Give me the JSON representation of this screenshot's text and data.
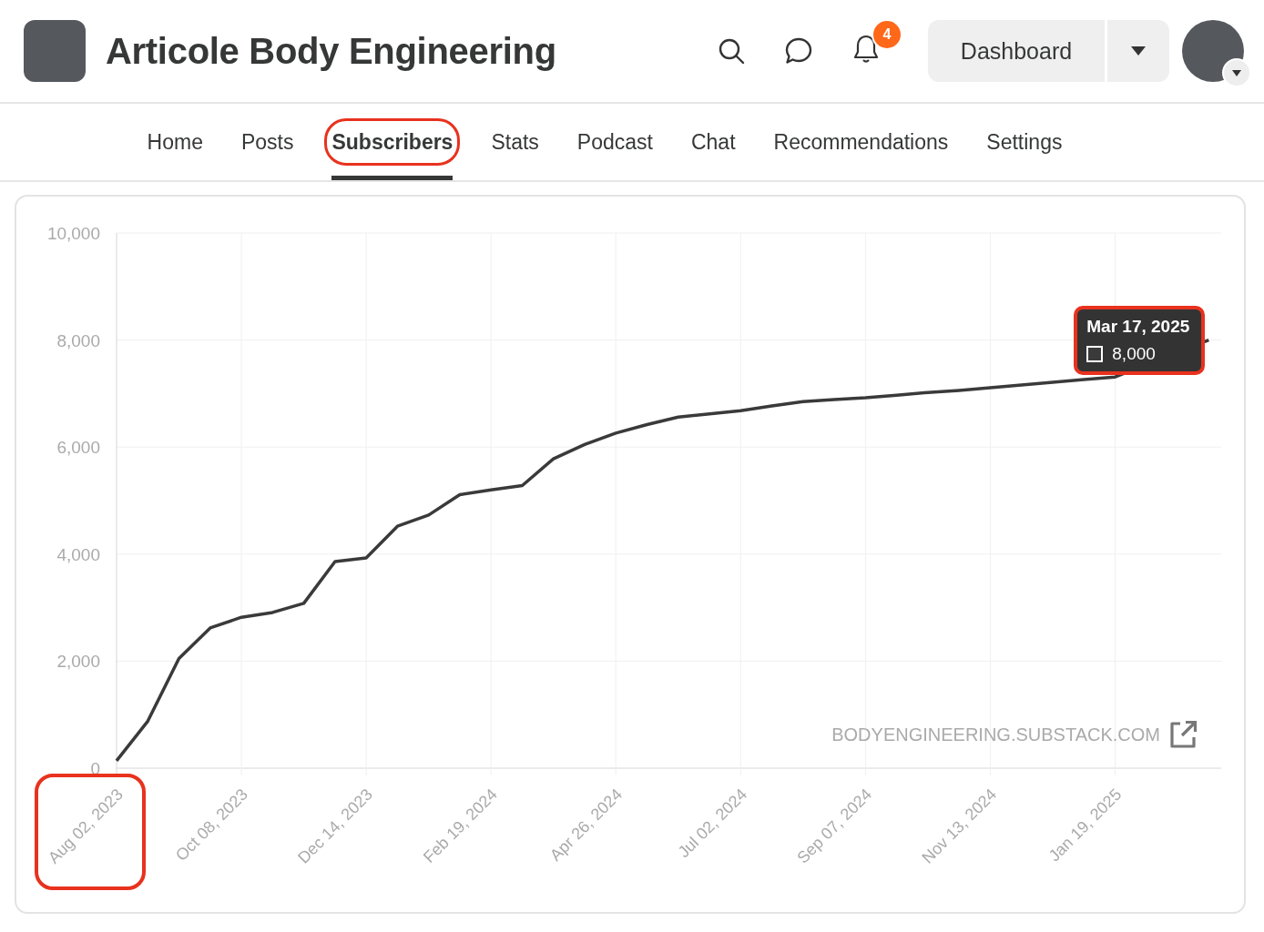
{
  "header": {
    "title": "Articole Body Engineering",
    "notifications_badge": "4",
    "dashboard_button": "Dashboard"
  },
  "nav": [
    {
      "label": "Home",
      "selected": false
    },
    {
      "label": "Posts",
      "selected": false
    },
    {
      "label": "Subscribers",
      "selected": true
    },
    {
      "label": "Stats",
      "selected": false
    },
    {
      "label": "Podcast",
      "selected": false
    },
    {
      "label": "Chat",
      "selected": false
    },
    {
      "label": "Recommendations",
      "selected": false
    },
    {
      "label": "Settings",
      "selected": false
    }
  ],
  "chart": {
    "watermark_link": "BODYENGINEERING.SUBSTACK.COM",
    "tooltip": {
      "date": "Mar 17, 2025",
      "value": "8,000"
    },
    "chart_data": {
      "type": "line",
      "categories": [
        "Aug 02, 2023",
        null,
        null,
        null,
        "Oct 08, 2023",
        null,
        null,
        null,
        "Dec 14, 2023",
        null,
        null,
        null,
        "Feb 19, 2024",
        null,
        null,
        null,
        "Apr 26, 2024",
        null,
        null,
        null,
        "Jul 02, 2024",
        null,
        null,
        null,
        "Sep 07, 2024",
        null,
        null,
        null,
        "Nov 13, 2024",
        null,
        null,
        null,
        "Jan 19, 2025",
        null,
        null,
        null
      ],
      "series": [
        {
          "color": "#3a3a3a",
          "values": [
            140,
            880,
            2050,
            2620,
            2820,
            2910,
            3080,
            3860,
            3930,
            4520,
            4730,
            5110,
            5200,
            5280,
            5780,
            6050,
            6260,
            6420,
            6560,
            6620,
            6680,
            6770,
            6850,
            6890,
            6920,
            6970,
            7020,
            7060,
            7110,
            7160,
            7210,
            7260,
            7310,
            null,
            null,
            8000
          ]
        }
      ],
      "ylim": [
        0,
        10000
      ],
      "grid": true,
      "yticks": [
        {
          "value": 0,
          "label": "0"
        },
        {
          "value": 2000,
          "label": "2,000"
        },
        {
          "value": 4000,
          "label": "4,000"
        },
        {
          "value": 6000,
          "label": "6,000"
        },
        {
          "value": 8000,
          "label": "8,000"
        },
        {
          "value": 10000,
          "label": "10,000"
        }
      ]
    }
  }
}
